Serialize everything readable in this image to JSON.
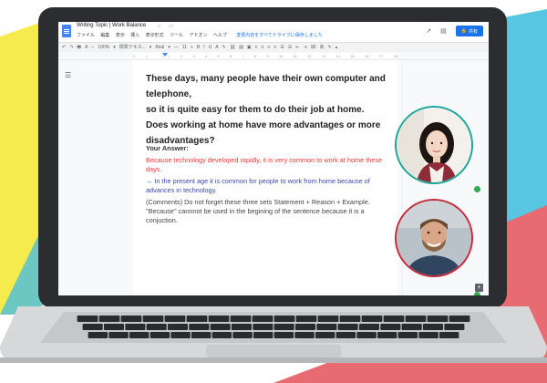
{
  "doc": {
    "title": "Writing Topic | Work Balance",
    "title_icons": "☆ ▭",
    "menus": [
      "ファイル",
      "編集",
      "表示",
      "挿入",
      "表示形式",
      "ツール",
      "アドオン",
      "ヘルプ"
    ],
    "save_status": "変更内容をすべてドライブに保存しました",
    "share_label": "共有",
    "icons": {
      "doc": "docs-icon",
      "trend": "activity-icon",
      "comment": "comment-icon",
      "lock": "lock-icon"
    }
  },
  "toolbar": {
    "items": [
      "↶",
      "↷",
      "🖶",
      "A",
      "⌐",
      "100%",
      "▾",
      "標準テキス...",
      "▾",
      "Arial",
      "▾",
      "—",
      "11",
      "+",
      "B",
      "I",
      "U",
      "A",
      "✎",
      "⛓",
      "▤",
      "▣",
      "≡",
      "≡",
      "≡",
      "≡",
      "☰",
      "☰",
      "⇤",
      "⇥",
      "⌧",
      "あ",
      "✎",
      "▴"
    ]
  },
  "ruler": {
    "ticks": [
      "2",
      "1",
      "",
      "1",
      "2",
      "3",
      "4",
      "5",
      "6",
      "7",
      "8",
      "9",
      "10",
      "11",
      "12",
      "13",
      "14",
      "15",
      "16",
      "17",
      "18"
    ]
  },
  "content": {
    "question": [
      "These days, many people have their own computer and telephone,",
      "so it is quite easy for them to do their job at home.",
      "Does working at home have more advantages or more",
      "disadvantages?"
    ],
    "answer_label": "Your Answer:",
    "answer_red": "Because technology developed rapidly, it is very common to work at home these days.",
    "answer_blue": "→ In the present age it is common for people to work from home because of advances in technology.",
    "answer_comment": "(Comments) Do not forget these three sets Statement + Reason + Example. \"Because\" cannnot be used in the begining of the sentence because it is a conjuction."
  },
  "participants": [
    {
      "name": "participant-1",
      "ring_color": "#1aa59a"
    },
    {
      "name": "participant-2",
      "ring_color": "#c62839"
    }
  ],
  "colors": {
    "brand": "#1a73e8",
    "online": "#34a853",
    "bg_yellow": "#f5eb4d",
    "bg_cyan": "#58c6e3",
    "bg_red": "#e96b72"
  }
}
